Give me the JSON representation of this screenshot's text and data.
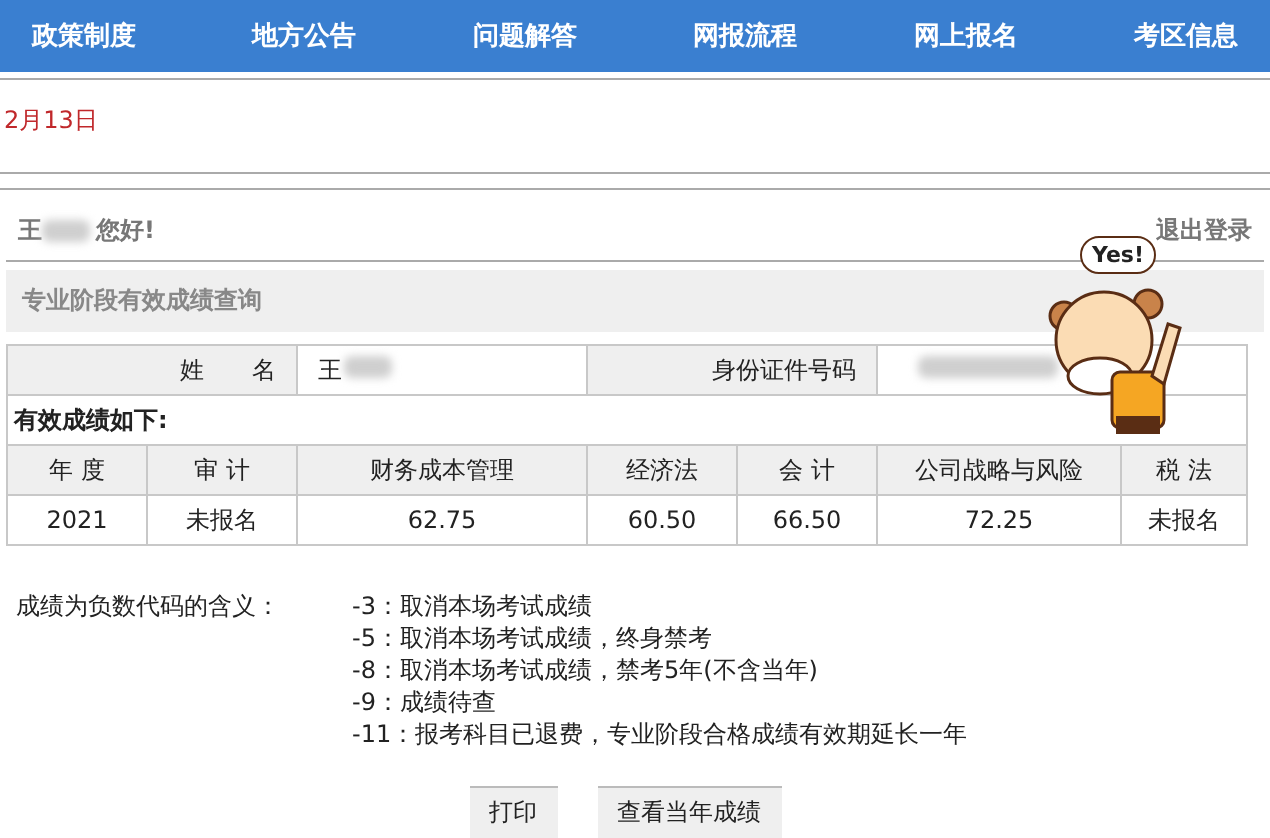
{
  "nav": [
    {
      "label": "政策制度"
    },
    {
      "label": "地方公告"
    },
    {
      "label": "问题解答"
    },
    {
      "label": "网报流程"
    },
    {
      "label": "网上报名"
    },
    {
      "label": "考区信息"
    }
  ],
  "date": "2月13日",
  "greeting": {
    "name": "王",
    "text": "您好!",
    "logout": "退出登录"
  },
  "section_title": "专业阶段有效成绩查询",
  "info": {
    "name_label": "姓　　名",
    "name_value": "王",
    "id_label": "身份证件号码"
  },
  "scores_caption": "有效成绩如下:",
  "table": {
    "columns": [
      "年 度",
      "审 计",
      "财务成本管理",
      "经济法",
      "会 计",
      "公司战略与风险",
      "税 法"
    ],
    "rows": [
      [
        "2021",
        "未报名",
        "62.75",
        "60.50",
        "66.50",
        "72.25",
        "未报名"
      ]
    ]
  },
  "legend": {
    "label": "成绩为负数代码的含义：",
    "items": [
      "-3：取消本场考试成绩",
      "-5：取消本场考试成绩，终身禁考",
      "-8：取消本场考试成绩，禁考5年(不含当年)",
      "-9：成绩待查",
      "-11：报考科目已退费，专业阶段合格成绩有效期延长一年"
    ]
  },
  "buttons": [
    "打印",
    "查看当年成绩"
  ],
  "sticker": {
    "text": "Yes!"
  }
}
